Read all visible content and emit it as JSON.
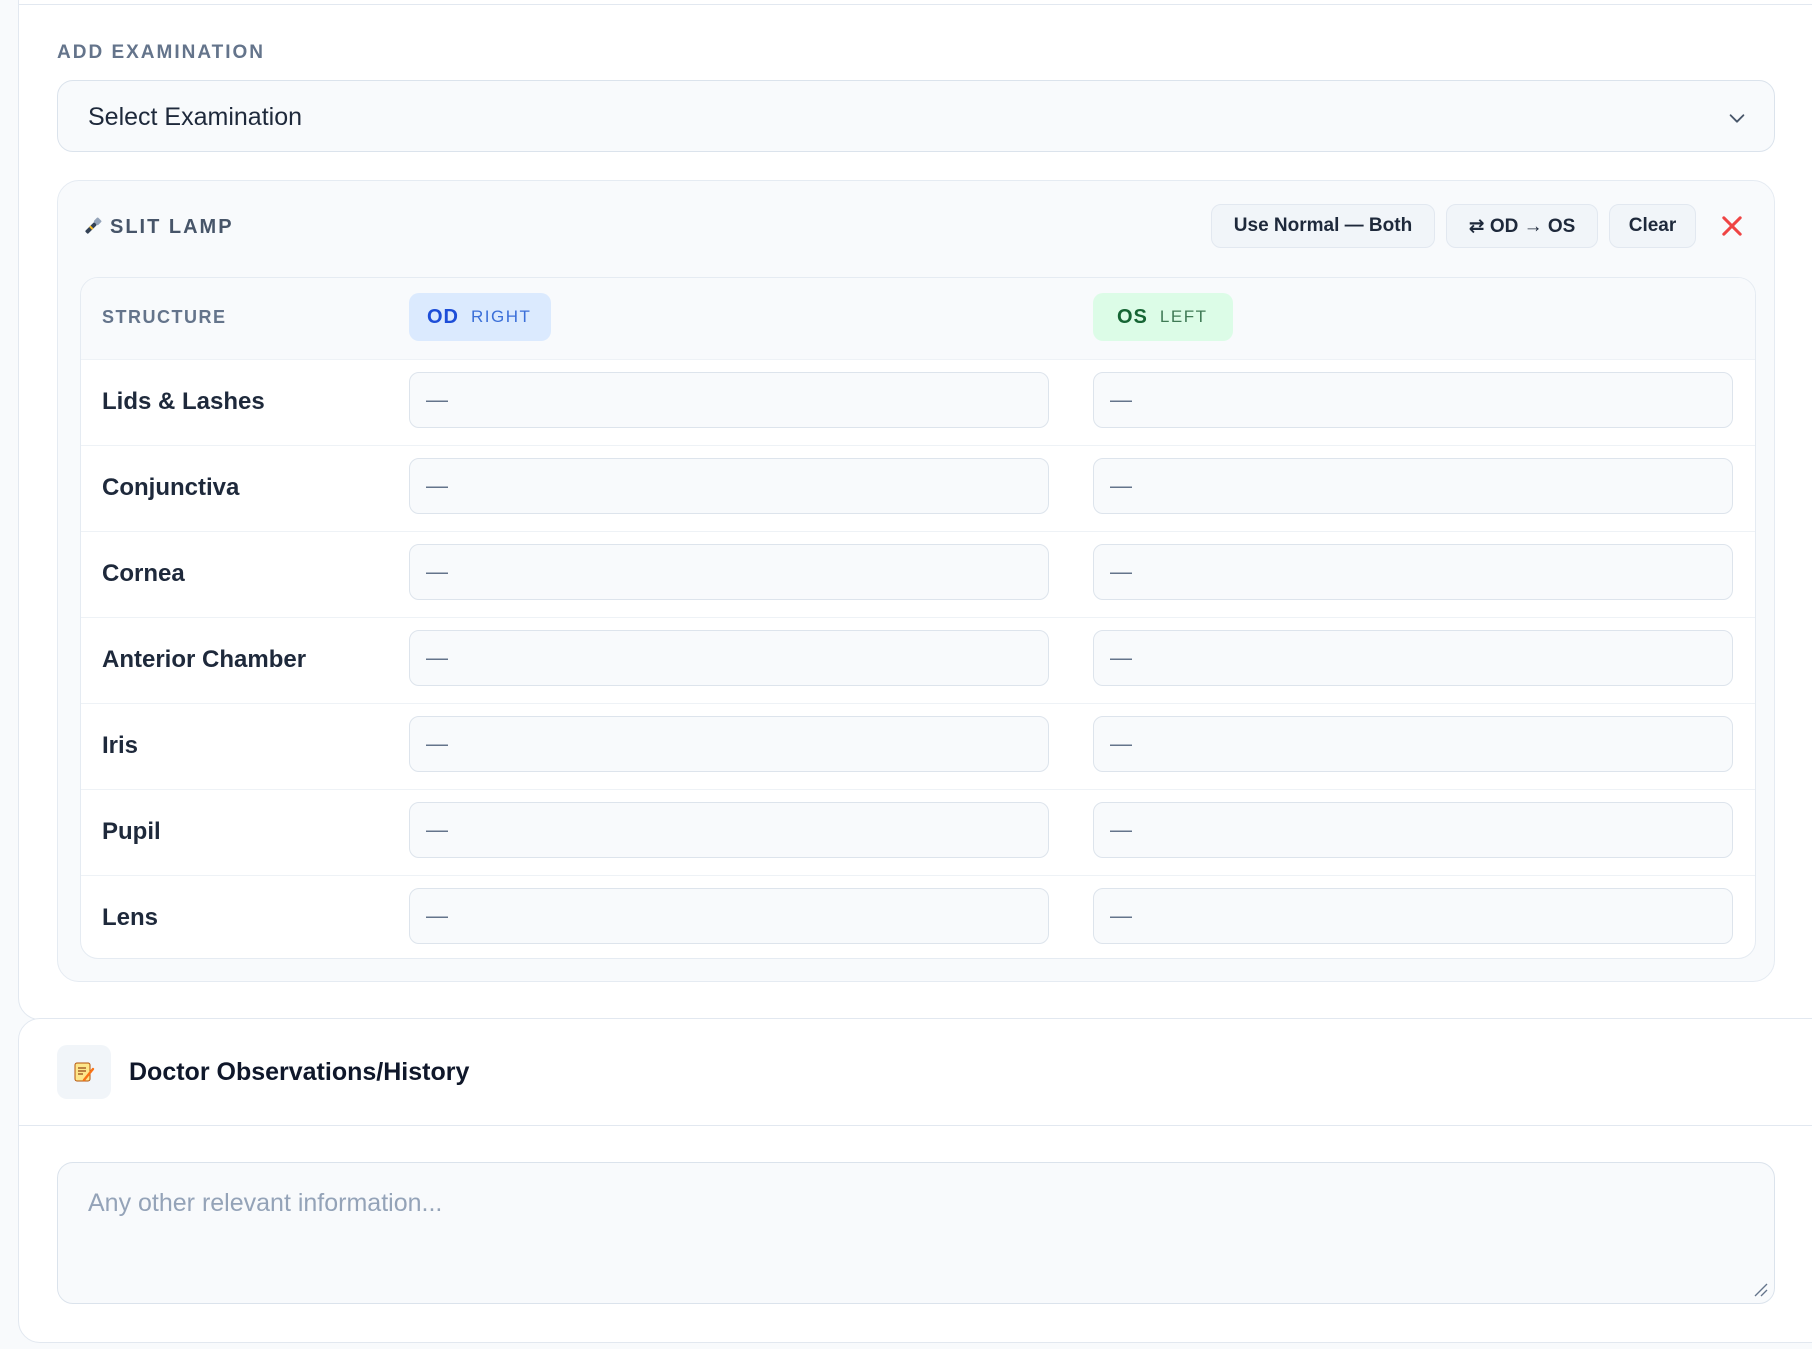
{
  "add_examination": {
    "label": "ADD EXAMINATION",
    "select_value": "Select Examination",
    "chevron_icon": "chevron-down-icon"
  },
  "exam": {
    "title": "SLIT LAMP",
    "icon": "flashlight-icon",
    "actions": {
      "use_normal": "Use Normal — Both",
      "copy_od_os": "⇄ OD → OS",
      "clear": "Clear",
      "close_icon": "close-icon"
    },
    "columns": {
      "structure": "STRUCTURE",
      "od_code": "OD",
      "od_label": "RIGHT",
      "os_code": "OS",
      "os_label": "LEFT"
    },
    "rows": [
      {
        "structure": "Lids & Lashes",
        "od": "—",
        "os": "—"
      },
      {
        "structure": "Conjunctiva",
        "od": "—",
        "os": "—"
      },
      {
        "structure": "Cornea",
        "od": "—",
        "os": "—"
      },
      {
        "structure": "Anterior Chamber",
        "od": "—",
        "os": "—"
      },
      {
        "structure": "Iris",
        "od": "—",
        "os": "—"
      },
      {
        "structure": "Pupil",
        "od": "—",
        "os": "—"
      },
      {
        "structure": "Lens",
        "od": "—",
        "os": "—"
      }
    ]
  },
  "observations": {
    "icon": "memo-icon",
    "title": "Doctor Observations/History",
    "placeholder": "Any other relevant information..."
  },
  "colors": {
    "od_accent": "#1d4ed8",
    "os_accent": "#166534",
    "close_red": "#ef4444"
  }
}
